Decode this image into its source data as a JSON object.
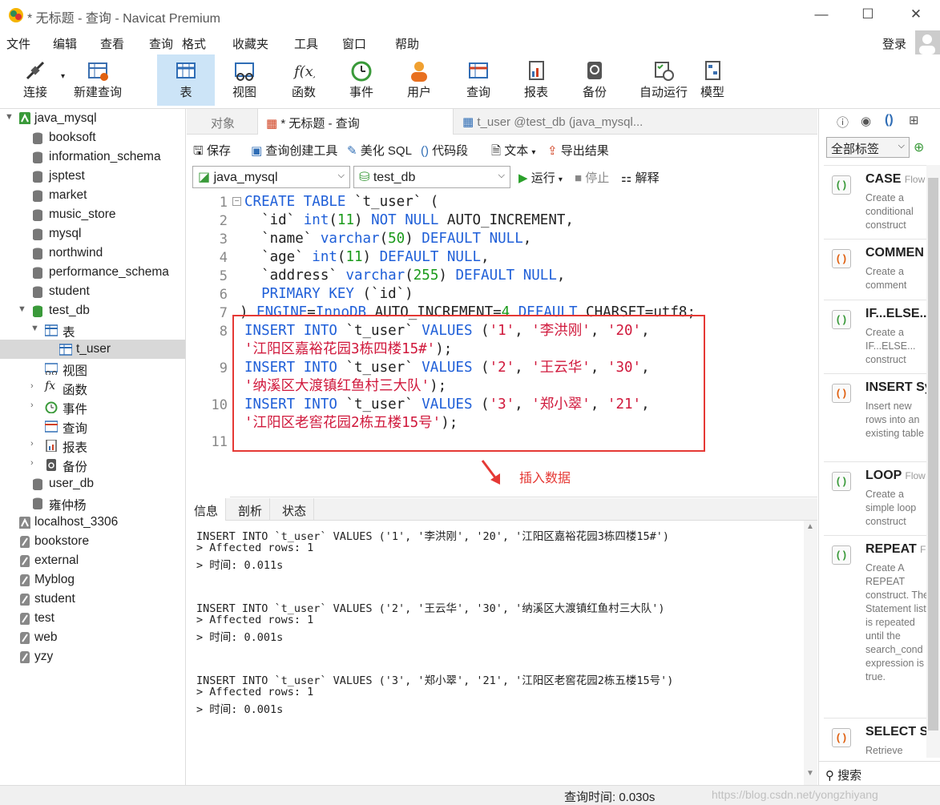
{
  "window": {
    "title": "* 无标题 - 查询 - Navicat Premium",
    "minimize": "—",
    "maximize": "☐",
    "close": "✕"
  },
  "menu": [
    "文件",
    "编辑",
    "查看",
    "查询",
    "格式",
    "收藏夹",
    "工具",
    "窗口",
    "帮助"
  ],
  "login": "登录",
  "toolbar": [
    "连接",
    "新建查询",
    "表",
    "视图",
    "函数",
    "事件",
    "用户",
    "查询",
    "报表",
    "备份",
    "自动运行",
    "模型"
  ],
  "tree": {
    "connection": "java_mysql",
    "dbs": [
      "booksoft",
      "information_schema",
      "jsptest",
      "market",
      "music_store",
      "mysql",
      "northwind",
      "performance_schema",
      "student",
      "test_db"
    ],
    "test_db_children": {
      "tables": "表",
      "t_user": "t_user",
      "views": "视图",
      "functions": "函数",
      "events": "事件",
      "queries": "查询",
      "reports": "报表",
      "backups": "备份"
    },
    "more_dbs": [
      "user_db",
      "雍仲杨"
    ],
    "other_connections": [
      "localhost_3306",
      "bookstore",
      "external",
      "Myblog",
      "student",
      "test",
      "web",
      "yzy"
    ]
  },
  "tabs": {
    "objects": "对象",
    "query": "* 无标题 - 查询",
    "table": "t_user @test_db (java_mysql..."
  },
  "qtool": {
    "save": "保存",
    "builder": "查询创建工具",
    "beautify": "美化 SQL",
    "snippet": "代码段",
    "text": "文本",
    "export": "导出结果"
  },
  "dbrow": {
    "conn": "java_mysql",
    "db": "test_db",
    "run": "运行",
    "stop": "停止",
    "explain": "解释"
  },
  "editor": {
    "lines": [
      "1",
      "2",
      "3",
      "4",
      "5",
      "6",
      "7",
      "8",
      "9",
      "10",
      "11"
    ],
    "note": "插入数据",
    "sql": {
      "l1": [
        "CREATE TABLE",
        " `t_user` ("
      ],
      "l2": [
        "  `id` ",
        "int",
        "(",
        "11",
        ") ",
        "NOT NULL",
        " AUTO_INCREMENT,"
      ],
      "l3": [
        "  `name` ",
        "varchar",
        "(",
        "50",
        ") ",
        "DEFAULT NULL",
        ","
      ],
      "l4": [
        "  `age` ",
        "int",
        "(",
        "11",
        ") ",
        "DEFAULT NULL",
        ","
      ],
      "l5": [
        "  `address` ",
        "varchar",
        "(",
        "255",
        ") ",
        "DEFAULT NULL",
        ","
      ],
      "l6": [
        "  PRIMARY KEY",
        " (`id`)"
      ],
      "l7": [
        ") ",
        "ENGINE",
        "=",
        "InnoDB",
        " AUTO_INCREMENT=",
        "4",
        " ",
        "DEFAULT",
        " CHARSET=utf8;"
      ],
      "i1": [
        "INSERT INTO",
        " `t_user` ",
        "VALUES",
        " (",
        "'1'",
        ", ",
        "'李洪刚'",
        ", ",
        "'20'",
        ","
      ],
      "i1b": [
        "'江阳区嘉裕花园3栋四楼15#'",
        ");"
      ],
      "i2": [
        "INSERT INTO",
        " `t_user` ",
        "VALUES",
        " (",
        "'2'",
        ", ",
        "'王云华'",
        ", ",
        "'30'",
        ","
      ],
      "i2b": [
        "'纳溪区大渡镇红鱼村三大队'",
        ");"
      ],
      "i3": [
        "INSERT INTO",
        " `t_user` ",
        "VALUES",
        " (",
        "'3'",
        ", ",
        "'郑小翠'",
        ", ",
        "'21'",
        ","
      ],
      "i3b": [
        "'江阳区老窖花园2栋五楼15号'",
        ");"
      ]
    }
  },
  "result_tabs": [
    "信息",
    "剖析",
    "状态"
  ],
  "messages": [
    "INSERT INTO `t_user` VALUES ('1', '李洪刚', '20', '江阳区嘉裕花园3栋四楼15#')",
    "> Affected rows: 1",
    "> 时间: 0.011s",
    "INSERT INTO `t_user` VALUES ('2', '王云华', '30', '纳溪区大渡镇红鱼村三大队')",
    "> Affected rows: 1",
    "> 时间: 0.001s",
    "INSERT INTO `t_user` VALUES ('3', '郑小翠', '21', '江阳区老窖花园2栋五楼15号')",
    "> Affected rows: 1",
    "> 时间: 0.001s"
  ],
  "status": {
    "query_time": "查询时间: 0.030s",
    "watermark": "https://blog.csdn.net/yongzhiyang"
  },
  "rpanel": {
    "filter": "全部标签",
    "search": "搜索",
    "snippets": [
      {
        "title": "CASE",
        "tag": "Flow",
        "desc": "Create a conditional construct"
      },
      {
        "title": "COMMEN",
        "tag": "",
        "desc": "Create a comment"
      },
      {
        "title": "IF...ELSE...",
        "tag": "",
        "desc": "Create a IF...ELSE... construct"
      },
      {
        "title": "INSERT Sy",
        "tag": "",
        "desc": "Insert new rows into an existing table"
      },
      {
        "title": "LOOP",
        "tag": "Flow",
        "desc": "Create a simple loop construct"
      },
      {
        "title": "REPEAT",
        "tag": "Fl",
        "desc": "Create A REPEAT construct. The Statement list is repeated until the search_cond expression is true."
      },
      {
        "title": "SELECT Sy",
        "tag": "",
        "desc": "Retrieve"
      }
    ]
  },
  "colors": {
    "keyword": "#1f5fd8",
    "number": "#1a9a1a",
    "string": "#d0193c",
    "highlight": "#e53935",
    "active_tool": "#cce4f7"
  }
}
